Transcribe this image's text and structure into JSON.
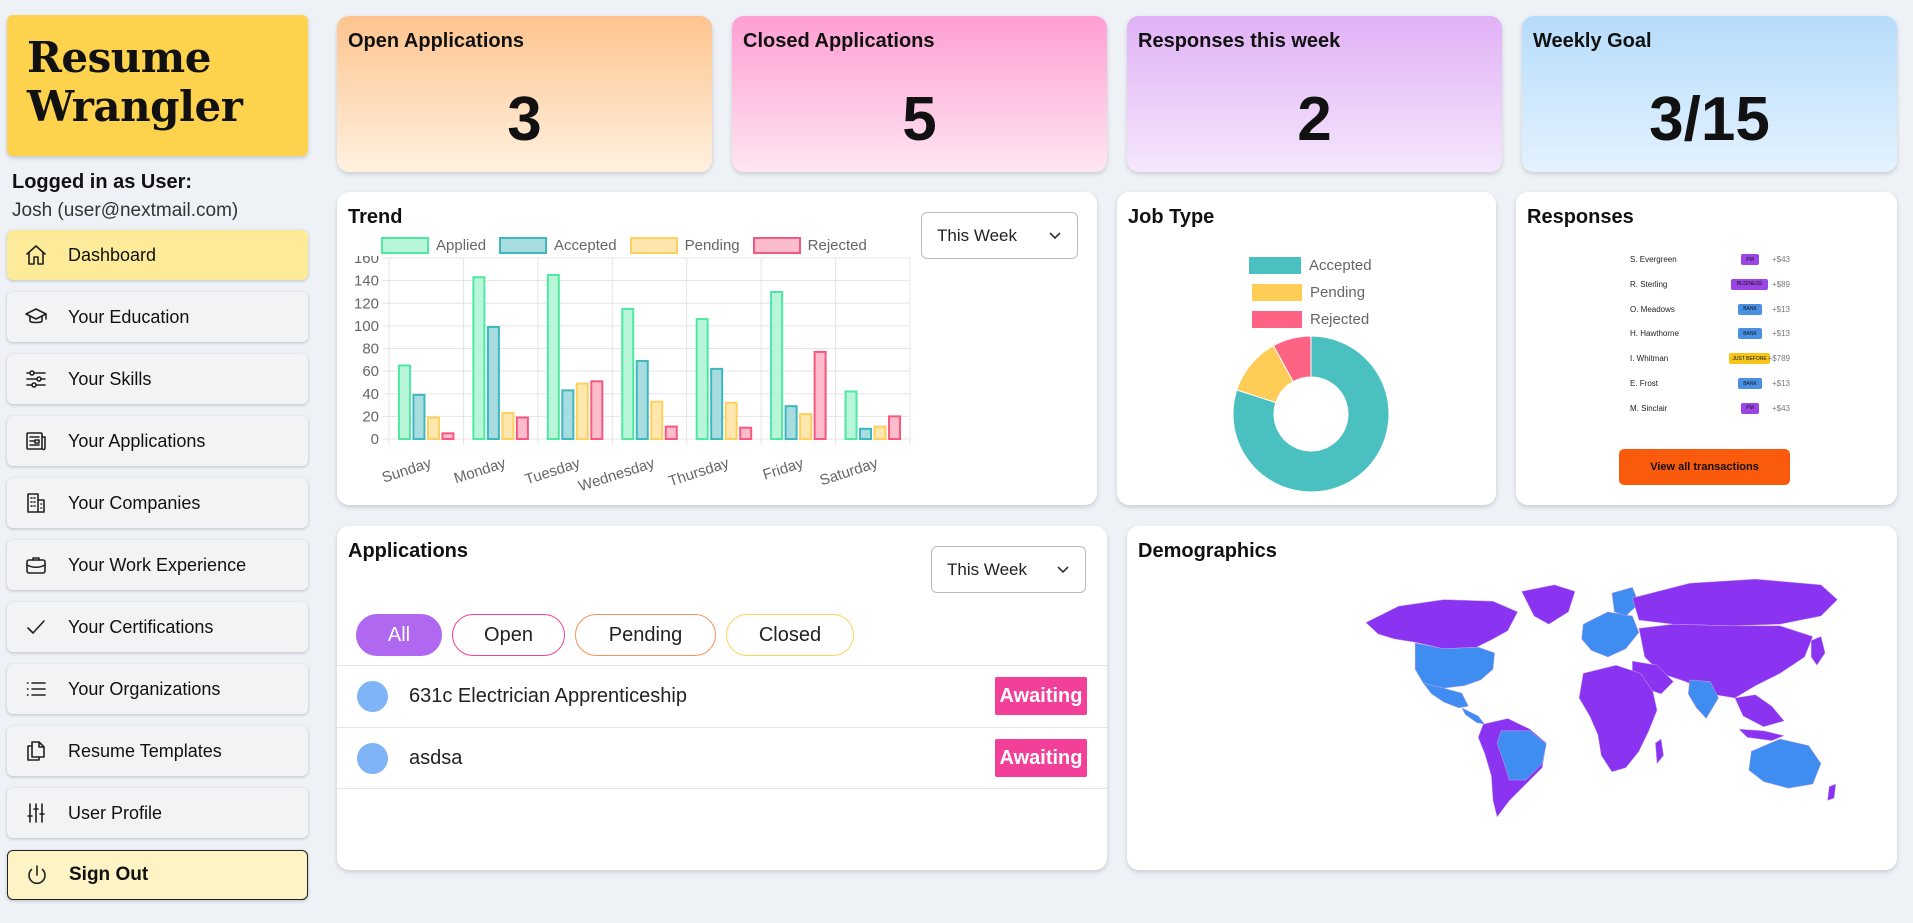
{
  "app": {
    "logo_line1": "Resume",
    "logo_line2": "Wrangler",
    "user_label": "Logged in as User:",
    "user_name": "Josh (user@nextmail.com)"
  },
  "nav": [
    {
      "label": "Dashboard",
      "icon": "home-icon",
      "active": true
    },
    {
      "label": "Your Education",
      "icon": "graduation-cap-icon"
    },
    {
      "label": "Your Skills",
      "icon": "sliders-icon"
    },
    {
      "label": "Your Applications",
      "icon": "newspaper-icon"
    },
    {
      "label": "Your Companies",
      "icon": "building-icon"
    },
    {
      "label": "Your Work Experience",
      "icon": "briefcase-icon"
    },
    {
      "label": "Your Certifications",
      "icon": "check-icon"
    },
    {
      "label": "Your Organizations",
      "icon": "list-icon"
    },
    {
      "label": "Resume Templates",
      "icon": "documents-icon"
    },
    {
      "label": "User Profile",
      "icon": "adjustments-icon"
    },
    {
      "label": "Sign Out",
      "icon": "power-icon"
    }
  ],
  "stats": [
    {
      "title": "Open Applications",
      "value": "3",
      "colors": [
        "#fec48e",
        "#fff1e0"
      ]
    },
    {
      "title": "Closed Applications",
      "value": "5",
      "colors": [
        "#ff9ed2",
        "#ffe6f3"
      ]
    },
    {
      "title": "Responses this week",
      "value": "2",
      "colors": [
        "#e0b1f6",
        "#f5e7fc"
      ]
    },
    {
      "title": "Weekly Goal",
      "value": "3/15",
      "colors": [
        "#b6dcfb",
        "#e4f2fe"
      ]
    }
  ],
  "trend": {
    "title": "Trend",
    "select_value": "This Week",
    "chart_data": {
      "type": "bar",
      "categories": [
        "Sunday",
        "Monday",
        "Tuesday",
        "Wednesday",
        "Thursday",
        "Friday",
        "Saturday"
      ],
      "series": [
        {
          "name": "Applied",
          "color": "#4ee8a3",
          "fill": "#b9f6d9",
          "values": [
            65,
            143,
            145,
            115,
            106,
            130,
            42
          ]
        },
        {
          "name": "Accepted",
          "color": "#3eb7bf",
          "fill": "#a8dde0",
          "values": [
            39,
            99,
            43,
            69,
            62,
            29,
            9
          ]
        },
        {
          "name": "Pending",
          "color": "#fcd15f",
          "fill": "#fde7ae",
          "values": [
            19,
            23,
            49,
            33,
            32,
            22,
            11
          ]
        },
        {
          "name": "Rejected",
          "color": "#f7587f",
          "fill": "#fbbccc",
          "values": [
            5,
            19,
            51,
            11,
            10,
            77,
            20
          ]
        }
      ],
      "ylim": [
        0,
        160
      ],
      "yticks": [
        "0",
        "20",
        "40",
        "60",
        "80",
        "100",
        "120",
        "140",
        "160"
      ],
      "grid": true,
      "legend": "top"
    }
  },
  "jobtype": {
    "title": "Job Type",
    "chart_data": {
      "type": "pie",
      "series": [
        {
          "name": "Accepted",
          "color": "#4bc0c0",
          "value": 80
        },
        {
          "name": "Pending",
          "color": "#ffcd56",
          "value": 12
        },
        {
          "name": "Rejected",
          "color": "#ff6384",
          "value": 8
        }
      ],
      "legend": "top"
    }
  },
  "responses": {
    "title": "Responses",
    "rows": [
      {
        "name": "S. Evergreen",
        "tag": "PM",
        "tag_color": "#9b45e4",
        "amount": "+$43"
      },
      {
        "name": "R. Sterling",
        "tag": "BUSINESS",
        "tag_color": "#9b45e4",
        "amount": "+$89"
      },
      {
        "name": "O. Meadows",
        "tag": "BANK",
        "tag_color": "#4a90e2",
        "amount": "+$13"
      },
      {
        "name": "H. Hawthorne",
        "tag": "BANK",
        "tag_color": "#4a90e2",
        "amount": "+$13"
      },
      {
        "name": "I. Whitman",
        "tag": "JUST BEFORE",
        "tag_color": "#f5c518",
        "amount": "+$789"
      },
      {
        "name": "E. Frost",
        "tag": "BANK",
        "tag_color": "#4a90e2",
        "amount": "+$13"
      },
      {
        "name": "M. Sinclair",
        "tag": "PM",
        "tag_color": "#9b45e4",
        "amount": "+$43"
      }
    ],
    "button_label": "View all transactions"
  },
  "applications": {
    "title": "Applications",
    "select_value": "This Week",
    "filters": [
      {
        "label": "All",
        "active": true,
        "color": "#b068f0"
      },
      {
        "label": "Open",
        "color": "#f23f97"
      },
      {
        "label": "Pending",
        "color": "#f7925a"
      },
      {
        "label": "Closed",
        "color": "#fcd15f"
      }
    ],
    "rows": [
      {
        "name": "631c Electrician Apprenticeship",
        "status": "Awaiting"
      },
      {
        "name": "asdsa",
        "status": "Awaiting"
      }
    ]
  },
  "demographics": {
    "title": "Demographics",
    "colors": {
      "land": "#8a33f0",
      "highlight": "#3f8df0"
    }
  }
}
